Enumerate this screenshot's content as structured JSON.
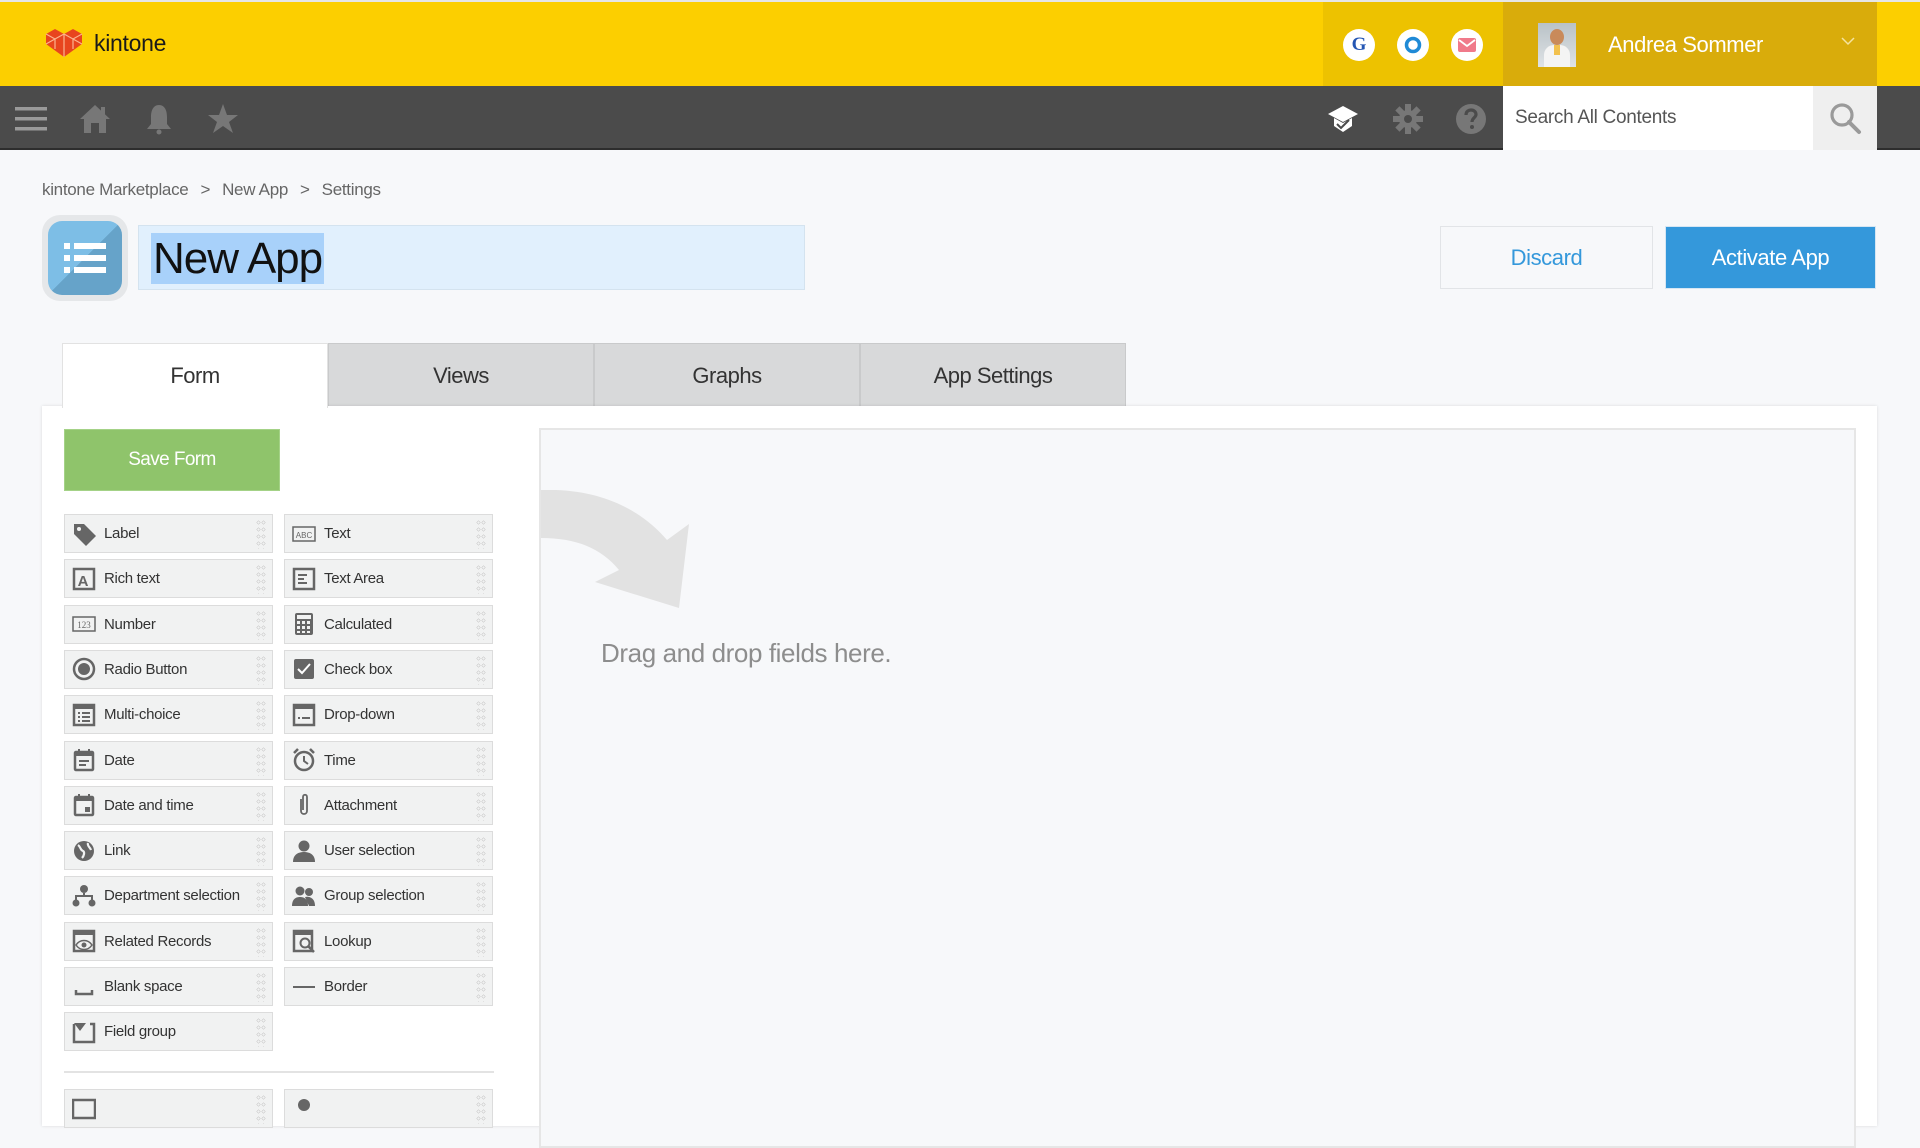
{
  "header": {
    "logo_text": "kintone",
    "quick_apps": [
      {
        "name": "google-icon",
        "glyph": "G",
        "color": "#2456b3"
      },
      {
        "name": "outlook-icon",
        "glyph": "O",
        "color": "#1f8ad6"
      },
      {
        "name": "mail-icon",
        "glyph": "✉",
        "color": "#f07a8a"
      }
    ],
    "user_name": "Andrea Sommer"
  },
  "nav": {
    "search_placeholder": "Search All Contents"
  },
  "breadcrumb": {
    "items": [
      "kintone Marketplace",
      "New App",
      "Settings"
    ],
    "separator": ">"
  },
  "app": {
    "title": "New App"
  },
  "actions": {
    "discard_label": "Discard",
    "activate_label": "Activate App"
  },
  "tabs": [
    {
      "label": "Form",
      "active": true
    },
    {
      "label": "Views",
      "active": false
    },
    {
      "label": "Graphs",
      "active": false
    },
    {
      "label": "App Settings",
      "active": false
    }
  ],
  "form": {
    "save_label": "Save Form",
    "fields": [
      {
        "label": "Label",
        "icon": "label-tag-icon"
      },
      {
        "label": "Text",
        "icon": "text-abc-icon"
      },
      {
        "label": "Rich text",
        "icon": "rich-text-icon"
      },
      {
        "label": "Text Area",
        "icon": "text-area-icon"
      },
      {
        "label": "Number",
        "icon": "number-icon"
      },
      {
        "label": "Calculated",
        "icon": "calculator-icon"
      },
      {
        "label": "Radio Button",
        "icon": "radio-button-icon"
      },
      {
        "label": "Check box",
        "icon": "checkbox-icon"
      },
      {
        "label": "Multi-choice",
        "icon": "multi-choice-icon"
      },
      {
        "label": "Drop-down",
        "icon": "drop-down-icon"
      },
      {
        "label": "Date",
        "icon": "date-icon"
      },
      {
        "label": "Time",
        "icon": "clock-icon"
      },
      {
        "label": "Date and time",
        "icon": "date-time-icon"
      },
      {
        "label": "Attachment",
        "icon": "paperclip-icon"
      },
      {
        "label": "Link",
        "icon": "globe-icon"
      },
      {
        "label": "User selection",
        "icon": "user-icon"
      },
      {
        "label": "Department selection",
        "icon": "org-chart-icon"
      },
      {
        "label": "Group selection",
        "icon": "group-icon"
      },
      {
        "label": "Related Records",
        "icon": "related-records-icon"
      },
      {
        "label": "Lookup",
        "icon": "lookup-icon"
      },
      {
        "label": "Blank space",
        "icon": "blank-space-icon"
      },
      {
        "label": "Border",
        "icon": "border-line-icon"
      },
      {
        "label": "Field group",
        "icon": "field-group-icon"
      }
    ],
    "drop_text": "Drag and drop fields here."
  }
}
